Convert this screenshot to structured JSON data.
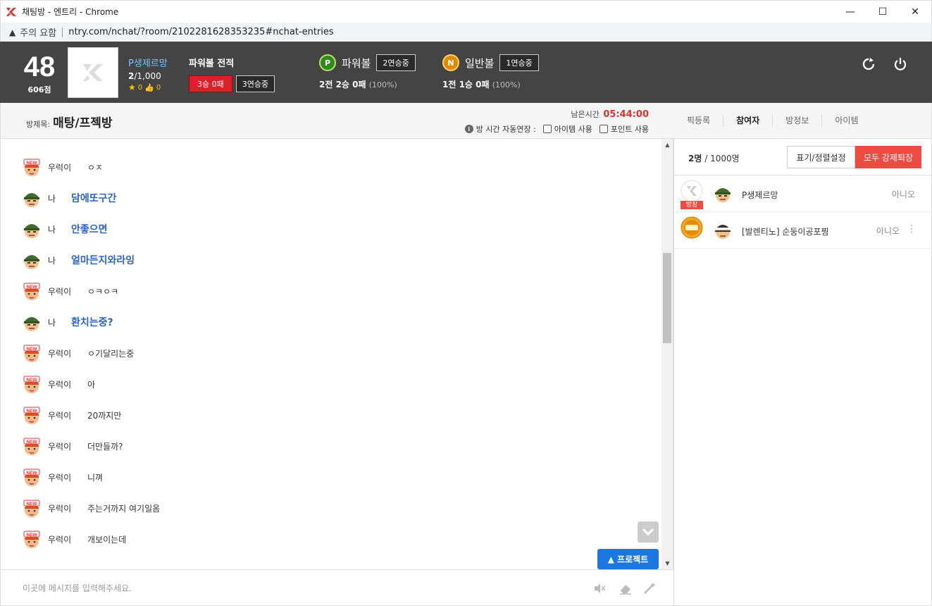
{
  "window": {
    "title": "채팅방 - 엔트리 - Chrome",
    "minimize": "—",
    "maximize": "☐",
    "close": "✕"
  },
  "address": {
    "warning": "주의 요함",
    "url": "ntry.com/nchat/?room/2102281628353235#nchat-entries"
  },
  "profile": {
    "level": "48",
    "points": "606점",
    "name": "P생제르망",
    "count_current": "2",
    "count_total": "/1,000",
    "stars": "0",
    "likes": "0"
  },
  "power_record": {
    "title": "파워볼 전적",
    "result": "3승 0패",
    "streak": "3연승중"
  },
  "powerball": {
    "icon_letter": "P",
    "name": "파워볼",
    "streak": "2연승중",
    "record": "2전 2승 0패",
    "pct": "(100%)"
  },
  "normalball": {
    "icon_letter": "N",
    "name": "일반볼",
    "streak": "1연승중",
    "record": "1전 1승 0패",
    "pct": "(100%)"
  },
  "room": {
    "label": "방제목:",
    "name": "매탕/프젝방",
    "time_label": "남은시간",
    "time": "05:44:00",
    "extend_label": "방 시간 자동연장 :",
    "opt_item": "아이템 사용",
    "opt_point": "포인트 사용"
  },
  "tabs": [
    "픽등록",
    "참여자",
    "방정보",
    "아이템"
  ],
  "chat": {
    "messages": [
      {
        "who": "우럭이",
        "text": "ㅇㅈ",
        "mine": false
      },
      {
        "who": "나",
        "text": "담에또구간",
        "mine": true
      },
      {
        "who": "나",
        "text": "안좋으면",
        "mine": true
      },
      {
        "who": "나",
        "text": "얼마든지와라잉",
        "mine": true
      },
      {
        "who": "우럭이",
        "text": "ㅇㅋㅇㅋ",
        "mine": false
      },
      {
        "who": "나",
        "text": "환치는중?",
        "mine": true
      },
      {
        "who": "우럭이",
        "text": "ㅇ기달리는중",
        "mine": false
      },
      {
        "who": "우럭이",
        "text": "아",
        "mine": false
      },
      {
        "who": "우럭이",
        "text": "20까지만",
        "mine": false
      },
      {
        "who": "우럭이",
        "text": "더만들까?",
        "mine": false
      },
      {
        "who": "우럭이",
        "text": "니껴",
        "mine": false
      },
      {
        "who": "우럭이",
        "text": "주는거까지 여기일옴",
        "mine": false
      },
      {
        "who": "우럭이",
        "text": "개보이는데",
        "mine": false
      }
    ],
    "protect_label": "프로젝트",
    "input_placeholder": "이곳에 메시지를 입력해주세요."
  },
  "participants": {
    "count": "2명",
    "total": "/ 1000명",
    "sort_label": "표기/정렬설정",
    "kick_label": "모두 강제퇴장",
    "host_tag": "방장",
    "list": [
      {
        "name": "P생제르망",
        "flag": "아니오"
      },
      {
        "name": "[발렌티노] 순둥이공포찡",
        "flag": "아니오"
      }
    ]
  },
  "colors": {
    "header_bg": "#444444",
    "accent_blue": "#1b76e0",
    "accent_red": "#ee4c43",
    "mine_text": "#2a64c8"
  }
}
